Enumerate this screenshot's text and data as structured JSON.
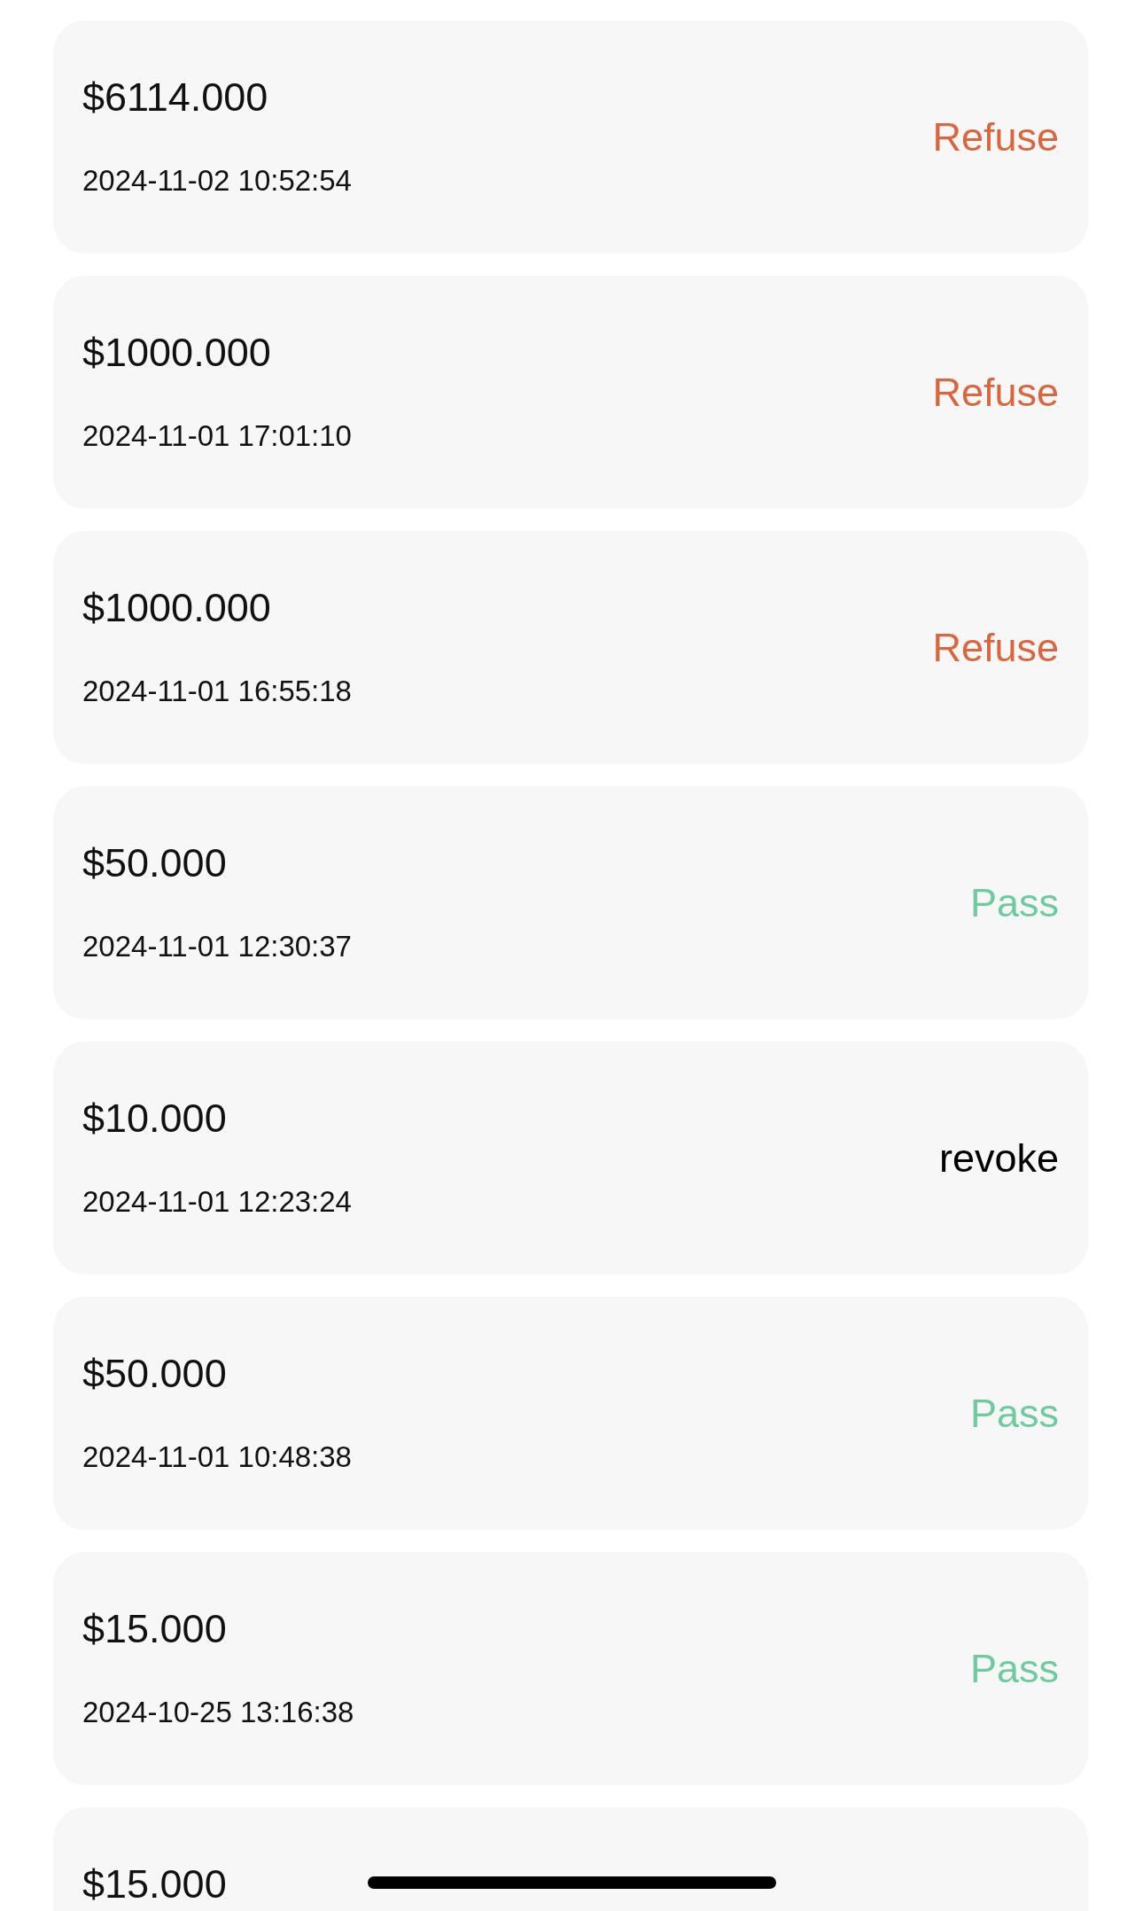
{
  "records": [
    {
      "amount": "$6114.000",
      "time": "2024-11-02 10:52:54",
      "status": {
        "text": "Refuse",
        "kind": "refuse"
      }
    },
    {
      "amount": "$1000.000",
      "time": "2024-11-01 17:01:10",
      "status": {
        "text": "Refuse",
        "kind": "refuse"
      }
    },
    {
      "amount": "$1000.000",
      "time": "2024-11-01 16:55:18",
      "status": {
        "text": "Refuse",
        "kind": "refuse"
      }
    },
    {
      "amount": "$50.000",
      "time": "2024-11-01 12:30:37",
      "status": {
        "text": "Pass",
        "kind": "pass"
      }
    },
    {
      "amount": "$10.000",
      "time": "2024-11-01 12:23:24",
      "status": {
        "text": "revoke",
        "kind": "revoke"
      }
    },
    {
      "amount": "$50.000",
      "time": "2024-11-01 10:48:38",
      "status": {
        "text": "Pass",
        "kind": "pass"
      }
    },
    {
      "amount": "$15.000",
      "time": "2024-10-25 13:16:38",
      "status": {
        "text": "Pass",
        "kind": "pass"
      }
    },
    {
      "amount": "$15.000"
    }
  ]
}
